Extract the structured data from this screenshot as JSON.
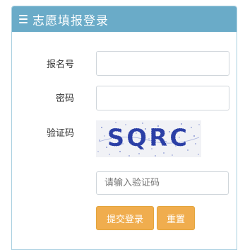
{
  "panel": {
    "title": "志愿填报登录",
    "icon": "menu-icon"
  },
  "form": {
    "username_label": "报名号",
    "username_value": "",
    "password_label": "密码",
    "password_value": "",
    "captcha_label": "验证码",
    "captcha_text": "SQRC",
    "captcha_placeholder": "请输入验证码",
    "submit_label": "提交登录",
    "reset_label": "重置"
  },
  "colors": {
    "header": "#6aabc8",
    "button": "#f0ad4e",
    "captcha_text": "#2b3fa6"
  }
}
